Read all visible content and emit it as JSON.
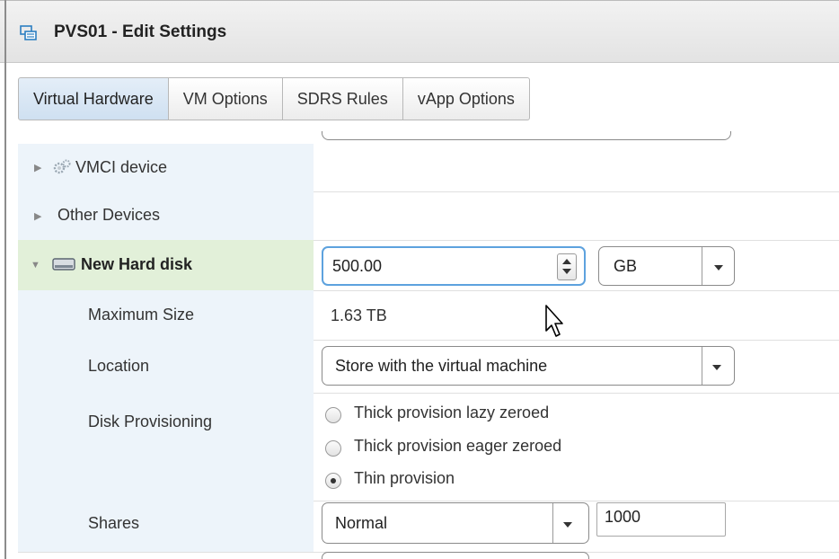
{
  "window": {
    "title": "PVS01 - Edit Settings"
  },
  "tabs": [
    {
      "label": "Virtual Hardware",
      "active": true
    },
    {
      "label": "VM Options",
      "active": false
    },
    {
      "label": "SDRS Rules",
      "active": false
    },
    {
      "label": "vApp Options",
      "active": false
    }
  ],
  "rows": {
    "vmci": {
      "label": "VMCI device"
    },
    "other_devices": {
      "label": "Other Devices"
    },
    "new_disk": {
      "label": "New Hard disk",
      "size_value": "500.00",
      "size_unit": "GB"
    },
    "max_size": {
      "label": "Maximum Size",
      "value": "1.63 TB"
    },
    "location": {
      "label": "Location",
      "value": "Store with the virtual machine"
    },
    "provisioning": {
      "label": "Disk Provisioning",
      "options": [
        {
          "label": "Thick provision lazy zeroed",
          "selected": false
        },
        {
          "label": "Thick provision eager zeroed",
          "selected": false
        },
        {
          "label": "Thin provision",
          "selected": true
        }
      ]
    },
    "shares": {
      "label": "Shares",
      "level": "Normal",
      "value": "1000"
    }
  },
  "colors": {
    "selected_row": "#e2f0d9",
    "label_column": "#edf4fa",
    "active_tab": "#cfe0f1"
  },
  "icons": [
    "vm-settings-icon",
    "gear-icon",
    "hard-disk-icon",
    "expand-arrow-icon",
    "collapse-arrow-icon",
    "spinner-up-icon",
    "spinner-down-icon",
    "dropdown-caret-icon",
    "mouse-pointer-icon"
  ]
}
